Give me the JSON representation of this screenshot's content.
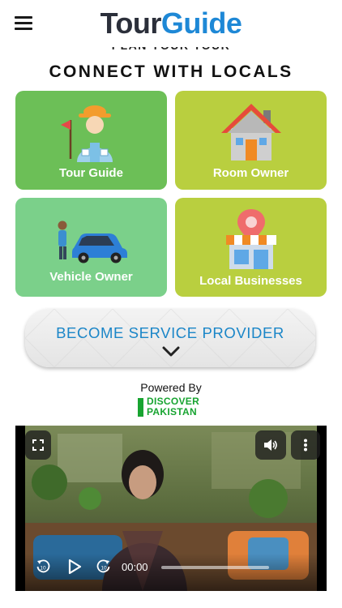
{
  "header": {
    "logo_part1": "Tour",
    "logo_part2": "Guide",
    "menu_icon": "hamburger-menu-icon"
  },
  "peek_heading": "PLAN YOUR TOUR",
  "section_title": "CONNECT WITH LOCALS",
  "cards": [
    {
      "label": "Tour Guide",
      "icon": "tour-guide-person-icon",
      "color": "#6cbf57"
    },
    {
      "label": "Room Owner",
      "icon": "house-icon",
      "color": "#b9cf3f"
    },
    {
      "label": "Vehicle Owner",
      "icon": "car-owner-icon",
      "color": "#7bd08a"
    },
    {
      "label": "Local Businesses",
      "icon": "shop-location-icon",
      "color": "#b9cf3f"
    }
  ],
  "become_provider": {
    "label": "BECOME SERVICE PROVIDER",
    "icon": "chevron-down-icon"
  },
  "powered_by": {
    "label": "Powered By",
    "brand_line1": "DISCOVER",
    "brand_line2": "PAKISTAN",
    "brand_color": "#18a431"
  },
  "video": {
    "current_time": "00:00",
    "progress": 0,
    "icons": [
      "fullscreen-icon",
      "volume-icon",
      "more-vertical-icon",
      "rewind-10-icon",
      "play-icon",
      "forward-10-icon"
    ]
  },
  "colors": {
    "accent_blue": "#1e88d6",
    "logo_dark": "#2b2f3a"
  }
}
